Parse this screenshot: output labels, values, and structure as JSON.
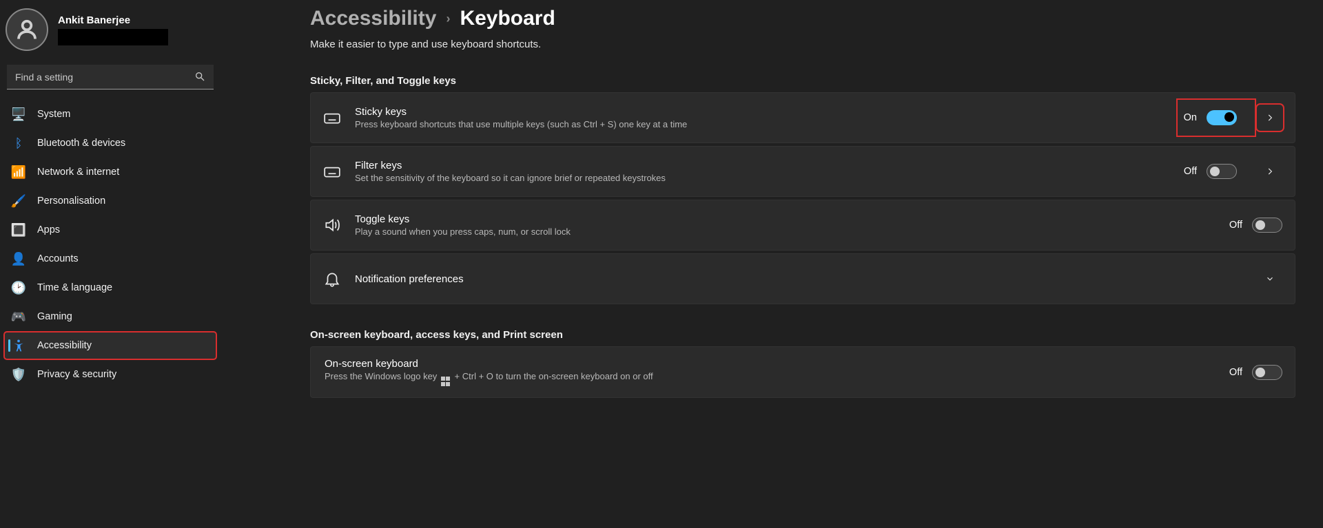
{
  "user": {
    "name": "Ankit Banerjee"
  },
  "search": {
    "placeholder": "Find a setting"
  },
  "nav": {
    "system": "System",
    "bluetooth": "Bluetooth & devices",
    "network": "Network & internet",
    "personalisation": "Personalisation",
    "apps": "Apps",
    "accounts": "Accounts",
    "time": "Time & language",
    "gaming": "Gaming",
    "accessibility": "Accessibility",
    "privacy": "Privacy & security"
  },
  "breadcrumb": {
    "parent": "Accessibility",
    "current": "Keyboard"
  },
  "subtitle": "Make it easier to type and use keyboard shortcuts.",
  "sections": {
    "s1": "Sticky, Filter, and Toggle keys",
    "s2": "On-screen keyboard, access keys, and Print screen"
  },
  "sticky": {
    "title": "Sticky keys",
    "desc": "Press keyboard shortcuts that use multiple keys (such as Ctrl + S) one key at a time",
    "state": "On"
  },
  "filter": {
    "title": "Filter keys",
    "desc": "Set the sensitivity of the keyboard so it can ignore brief or repeated keystrokes",
    "state": "Off"
  },
  "toggle": {
    "title": "Toggle keys",
    "desc": "Play a sound when you press caps, num, or scroll lock",
    "state": "Off"
  },
  "notif": {
    "title": "Notification preferences"
  },
  "osk": {
    "title": "On-screen keyboard",
    "desc_pre": "Press the Windows logo key ",
    "desc_post": " + Ctrl + O to turn the on-screen keyboard on or off",
    "state": "Off"
  }
}
